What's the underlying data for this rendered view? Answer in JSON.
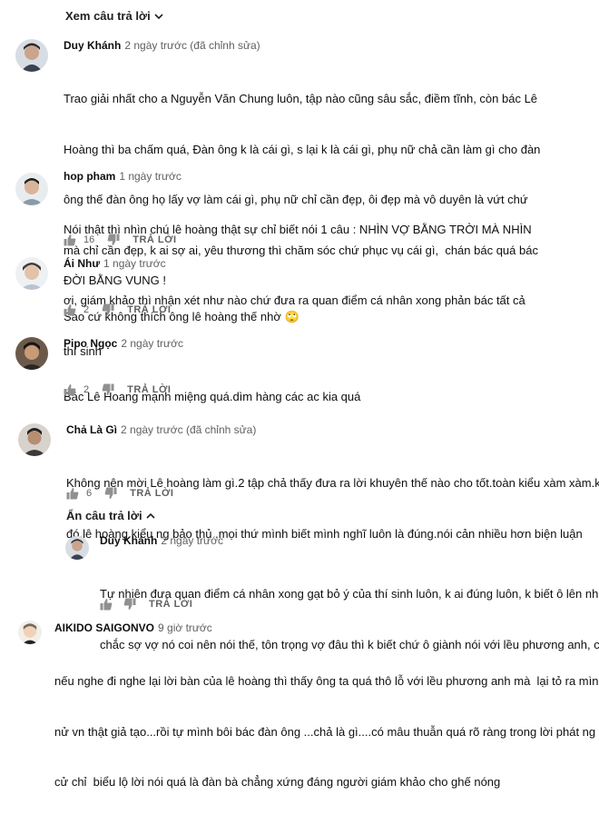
{
  "view_replies_label": "Xem câu trả lời",
  "hide_replies_label": "Ẩn câu trả lời",
  "reply_label": "TRẢ LỜI",
  "comments": [
    {
      "author": "Duy Khánh",
      "time": "2 ngày trước (đã chỉnh sửa)",
      "lines": [
        "Trao giải nhất cho a Nguyễn Văn Chung luôn, tập nào cũng sâu sắc, điềm tĩnh, còn bác Lê",
        "Hoàng thì ba chấm quá, Đàn ông k là cái gì, s lại k là cái gì, phụ nữ chả cần làm gì cho đàn",
        "ông thế đàn ông họ lấy vợ làm cái gì, phụ nữ chỉ cần đẹp, ôi đẹp mà vô duyên là vứt chứ",
        "mà chỉ cần đẹp, k ai sợ ai, yêu thương thì chăm sóc chứ phục vụ cái gì,  chán bác quá bác",
        "ơi, giám khảo thì nhận xét như nào chứ đưa ra quan điểm cá nhân xong phản bác tất cả",
        "thí sinh"
      ]
    },
    {
      "author": "hop pham",
      "time": "1 ngày trước",
      "lines": [
        "Nói thật thì nhìn chú lê hoàng thật sự chỉ biết nói 1 câu : NHÌN VỢ BẰNG TRỜI MÀ NHÌN",
        "ĐỜI BẰNG VUNG !"
      ],
      "likes": "16"
    },
    {
      "author": "Ái Như",
      "time": "1 ngày trước",
      "lines": [
        "Sao cứ không thích ông lê hoàng thế nhờ 🙄"
      ],
      "likes": "2"
    },
    {
      "author": "Pipo Ngọc",
      "time": "2 ngày trước",
      "lines": [
        "Bác Lê Hoang mạnh miệng quá.dìm hàng các ac kia quá"
      ],
      "likes": "2"
    },
    {
      "author": "Chả Là Gì",
      "time": "2 ngày trước (đã chỉnh sửa)",
      "lines": [
        "Không nên mời Lê hoàng làm gì.2 tập chả thấy đưa ra lời khuyên thế nào cho tốt.toàn kiểu xàm xàm.k",
        "đó.lê hoàng kiểu ng bảo thủ .mọi thứ mình biết mình nghĩ luôn là đúng.nói cản nhiều hơn biện luận"
      ],
      "likes": "6"
    },
    {
      "author": "Duy Khánh",
      "time": "2 ngày trước",
      "lines": [
        "Tự nhiên đưa quan điểm cá nhân xong gạt bỏ ý của thí sinh luôn, k ai đúng luôn, k biết ô lên nh",
        "chắc sợ vợ nó coi nên nói thế, tôn trọng vợ đâu thì k biết chứ ô giành nói với lều phương anh, ch"
      ]
    },
    {
      "author": "AIKIDO SAIGONVO",
      "time": "9 giờ trước",
      "lines": [
        "nếu nghe đi nghe lại lời bàn của lê hoàng thì thấy ông ta quá thô lỗ với lều phương anh mà  lại tỏ ra mình",
        "nử vn thật giả tạo...rồi tự mình bôi bác đàn ông ...chả là gì....có mâu thuẫn quá rõ ràng trong lời phát ng",
        "cử chỉ  biểu lộ lời nói quá là đàn bà chẳng xứng đáng người giám khảo cho ghế nóng"
      ]
    }
  ],
  "colors": {
    "text": "#0f0f0f",
    "meta": "#606060",
    "background": "#ffffff"
  }
}
